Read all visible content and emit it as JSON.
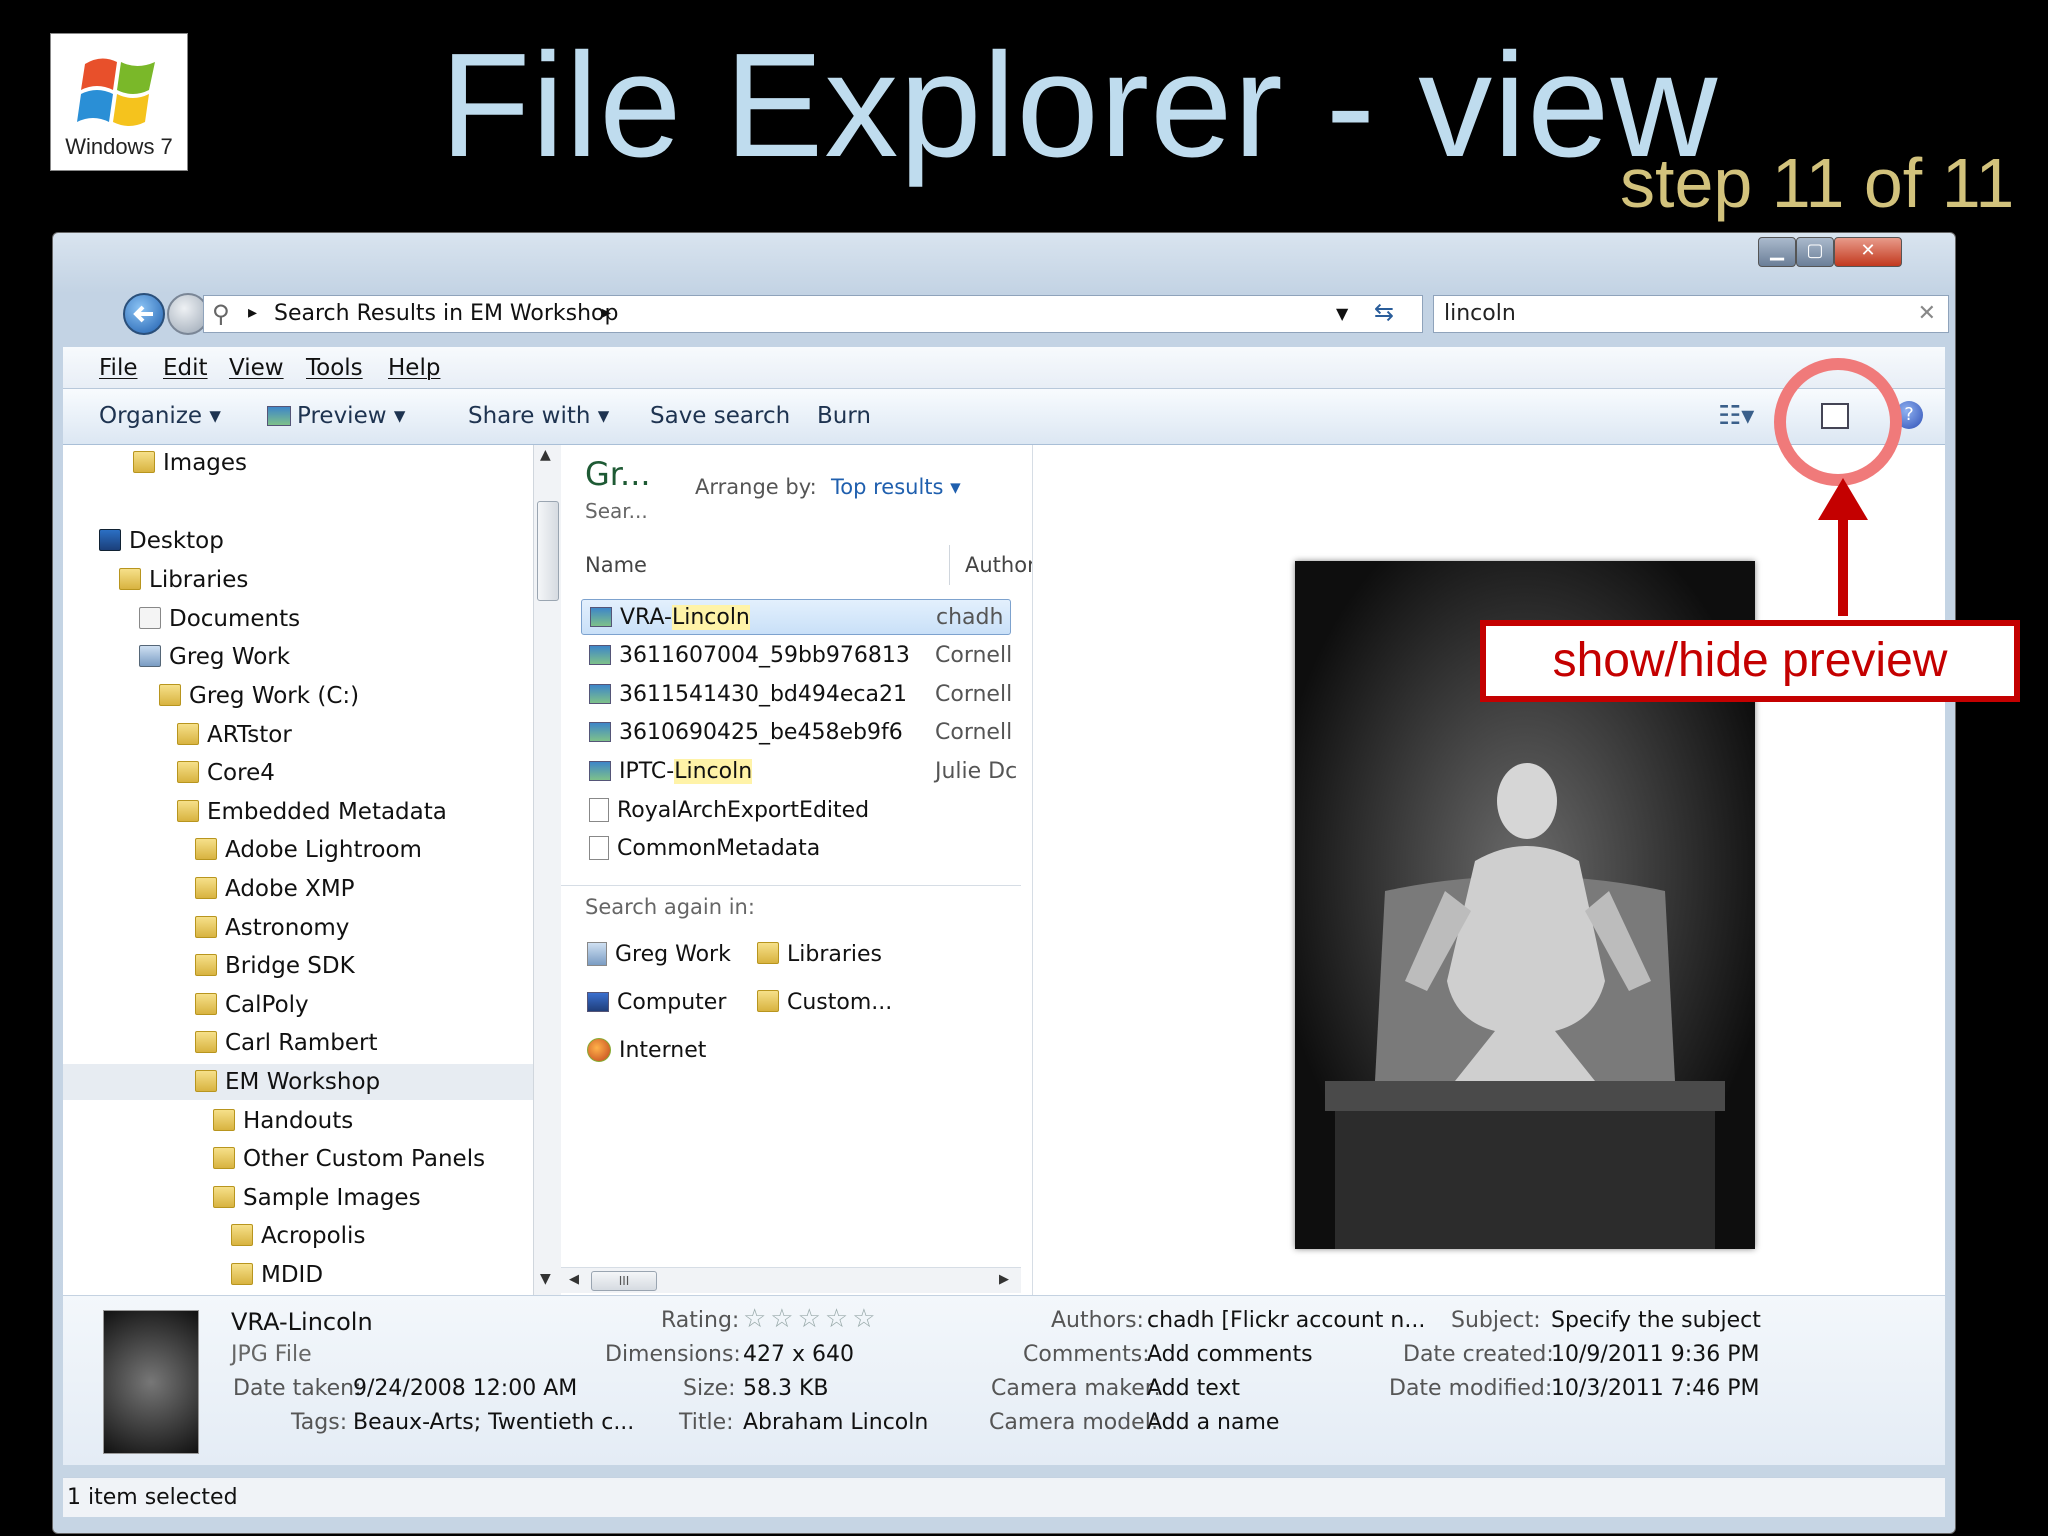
{
  "slide": {
    "title": "File Explorer - view",
    "step": "step 11 of 11",
    "logo_text": "Windows 7"
  },
  "window": {
    "address": {
      "crumb": "Search Results in EM Workshop"
    },
    "search": {
      "value": "lincoln"
    },
    "menu": [
      "File",
      "Edit",
      "View",
      "Tools",
      "Help"
    ],
    "commands": {
      "organize": "Organize",
      "preview": "Preview",
      "share": "Share with",
      "save_search": "Save search",
      "burn": "Burn"
    },
    "nav_tree": [
      {
        "label": "Images",
        "icon": "folder-icon"
      },
      {
        "label": "Desktop",
        "icon": "desktop-icon"
      },
      {
        "label": "Libraries",
        "icon": "libraries-icon"
      },
      {
        "label": "Documents",
        "icon": "documents-icon"
      },
      {
        "label": "Greg Work",
        "icon": "library-icon"
      },
      {
        "label": "Greg Work (C:)",
        "icon": "folder-icon"
      },
      {
        "label": "ARTstor",
        "icon": "folder-icon"
      },
      {
        "label": "Core4",
        "icon": "folder-icon"
      },
      {
        "label": "Embedded Metadata",
        "icon": "folder-icon"
      },
      {
        "label": "Adobe Lightroom",
        "icon": "folder-icon"
      },
      {
        "label": "Adobe XMP",
        "icon": "folder-icon"
      },
      {
        "label": "Astronomy",
        "icon": "folder-icon"
      },
      {
        "label": "Bridge SDK",
        "icon": "folder-icon"
      },
      {
        "label": "CalPoly",
        "icon": "folder-icon"
      },
      {
        "label": "Carl Rambert",
        "icon": "folder-icon"
      },
      {
        "label": "EM Workshop",
        "icon": "folder-icon",
        "selected": true
      },
      {
        "label": "Handouts",
        "icon": "folder-icon"
      },
      {
        "label": "Other Custom Panels",
        "icon": "folder-icon"
      },
      {
        "label": "Sample Images",
        "icon": "folder-icon"
      },
      {
        "label": "Acropolis",
        "icon": "folder-icon"
      },
      {
        "label": "MDID",
        "icon": "folder-icon"
      }
    ],
    "files_pane": {
      "group_title": "Gr...",
      "group_sub": "Sear...",
      "arrange_label": "Arrange by:",
      "arrange_value": "Top results",
      "columns": [
        "Name",
        "Author"
      ],
      "rows": [
        {
          "prefix": "VRA-",
          "match": "Lincoln",
          "author": "chadh",
          "icon": "image-icon",
          "selected": true
        },
        {
          "prefix": "3611607004_59bb976813",
          "match": "",
          "author": "Cornell",
          "icon": "image-icon"
        },
        {
          "prefix": "3611541430_bd494eca21",
          "match": "",
          "author": "Cornell",
          "icon": "image-icon"
        },
        {
          "prefix": "3610690425_be458eb9f6",
          "match": "",
          "author": "Cornell",
          "icon": "image-icon"
        },
        {
          "prefix": "IPTC-",
          "match": "Lincoln",
          "author": "Julie Dc",
          "icon": "image-icon"
        },
        {
          "prefix": "RoyalArchExportEdited",
          "match": "",
          "author": "",
          "icon": "document-icon"
        },
        {
          "prefix": "CommonMetadata",
          "match": "",
          "author": "",
          "icon": "document-icon"
        }
      ],
      "search_again_label": "Search again in:",
      "search_again": [
        {
          "label": "Greg Work",
          "icon": "library-icon"
        },
        {
          "label": "Libraries",
          "icon": "libraries-icon"
        },
        {
          "label": "Computer",
          "icon": "computer-icon"
        },
        {
          "label": "Custom...",
          "icon": "custom-folder-icon"
        },
        {
          "label": "Internet",
          "icon": "internet-icon"
        }
      ],
      "hscroll_glyph": "III"
    },
    "details": {
      "name": "VRA-Lincoln",
      "type": "JPG File",
      "date_taken_label": "Date taken:",
      "date_taken": "9/24/2008 12:00 AM",
      "tags_label": "Tags:",
      "tags": "Beaux-Arts; Twentieth c...",
      "rating_label": "Rating:",
      "rating_stars": "☆☆☆☆☆",
      "dimensions_label": "Dimensions:",
      "dimensions": "427 x 640",
      "size_label": "Size:",
      "size": "58.3 KB",
      "title_label": "Title:",
      "title": "Abraham Lincoln",
      "authors_label": "Authors:",
      "authors": "chadh [Flickr account n...",
      "comments_label": "Comments:",
      "comments": "Add comments",
      "camera_maker_label": "Camera maker:",
      "camera_maker": "Add text",
      "camera_model_label": "Camera model:",
      "camera_model": "Add a name",
      "subject_label": "Subject:",
      "subject": "Specify the subject",
      "date_created_label": "Date created:",
      "date_created": "10/9/2011 9:36 PM",
      "date_modified_label": "Date modified:",
      "date_modified": "10/3/2011 7:46 PM"
    },
    "status": "1 item selected"
  },
  "callout": {
    "text": "show/hide preview",
    "color": "#c40000"
  }
}
